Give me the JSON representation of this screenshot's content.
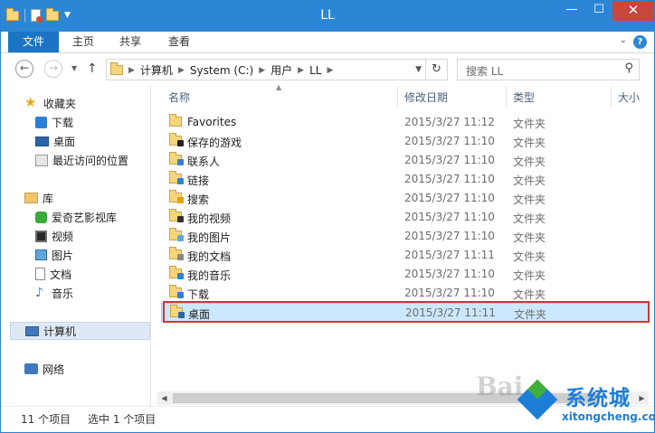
{
  "window": {
    "title": "LL"
  },
  "window_controls": {
    "minimize": "—",
    "maximize": "☐",
    "close": "✕"
  },
  "ribbon": {
    "tabs": [
      "文件",
      "主页",
      "共享",
      "查看"
    ],
    "help_icon": "question-icon",
    "help": "?",
    "expand": "⌄"
  },
  "address": {
    "back": "←",
    "forward": "→",
    "up": "↑",
    "crumbs": [
      "计算机",
      "System (C:)",
      "用户",
      "LL"
    ],
    "search_placeholder": "搜索 LL"
  },
  "nav": {
    "favorites": {
      "label": "收藏夹",
      "items": [
        "下载",
        "桌面",
        "最近访问的位置"
      ]
    },
    "libraries": {
      "label": "库",
      "items": [
        "爱奇艺影视库",
        "视频",
        "图片",
        "文档",
        "音乐"
      ]
    },
    "computer": "计算机",
    "network": "网络"
  },
  "columns": {
    "name": "名称",
    "date": "修改日期",
    "type": "类型",
    "size": "大小"
  },
  "files": [
    {
      "name": "Favorites",
      "date": "2015/3/27 11:12",
      "type": "文件夹",
      "badge": ""
    },
    {
      "name": "保存的游戏",
      "date": "2015/3/27 11:10",
      "type": "文件夹",
      "badge": "#222222"
    },
    {
      "name": "联系人",
      "date": "2015/3/27 11:10",
      "type": "文件夹",
      "badge": "#3a7bd5"
    },
    {
      "name": "链接",
      "date": "2015/3/27 11:10",
      "type": "文件夹",
      "badge": "#2d7fd3"
    },
    {
      "name": "搜索",
      "date": "2015/3/27 11:10",
      "type": "文件夹",
      "badge": "#e0a100"
    },
    {
      "name": "我的视频",
      "date": "2015/3/27 11:10",
      "type": "文件夹",
      "badge": "#333333"
    },
    {
      "name": "我的图片",
      "date": "2015/3/27 11:10",
      "type": "文件夹",
      "badge": "#5fa7d9"
    },
    {
      "name": "我的文档",
      "date": "2015/3/27 11:11",
      "type": "文件夹",
      "badge": "#888888"
    },
    {
      "name": "我的音乐",
      "date": "2015/3/27 11:10",
      "type": "文件夹",
      "badge": "#2d7fd3"
    },
    {
      "name": "下载",
      "date": "2015/3/27 11:10",
      "type": "文件夹",
      "badge": "#2d7fd3"
    },
    {
      "name": "桌面",
      "date": "2015/3/27 11:11",
      "type": "文件夹",
      "badge": "#2c64a8",
      "selected": true
    }
  ],
  "status": {
    "count": "11 个项目",
    "selected": "选中 1 个项目"
  },
  "watermark": {
    "baidu": "Bai",
    "brand": "系统城",
    "url": "xitongcheng.com"
  },
  "colors": {
    "accent": "#2b87d6",
    "selection": "#cce8ff",
    "highlight_box": "#d13438"
  }
}
